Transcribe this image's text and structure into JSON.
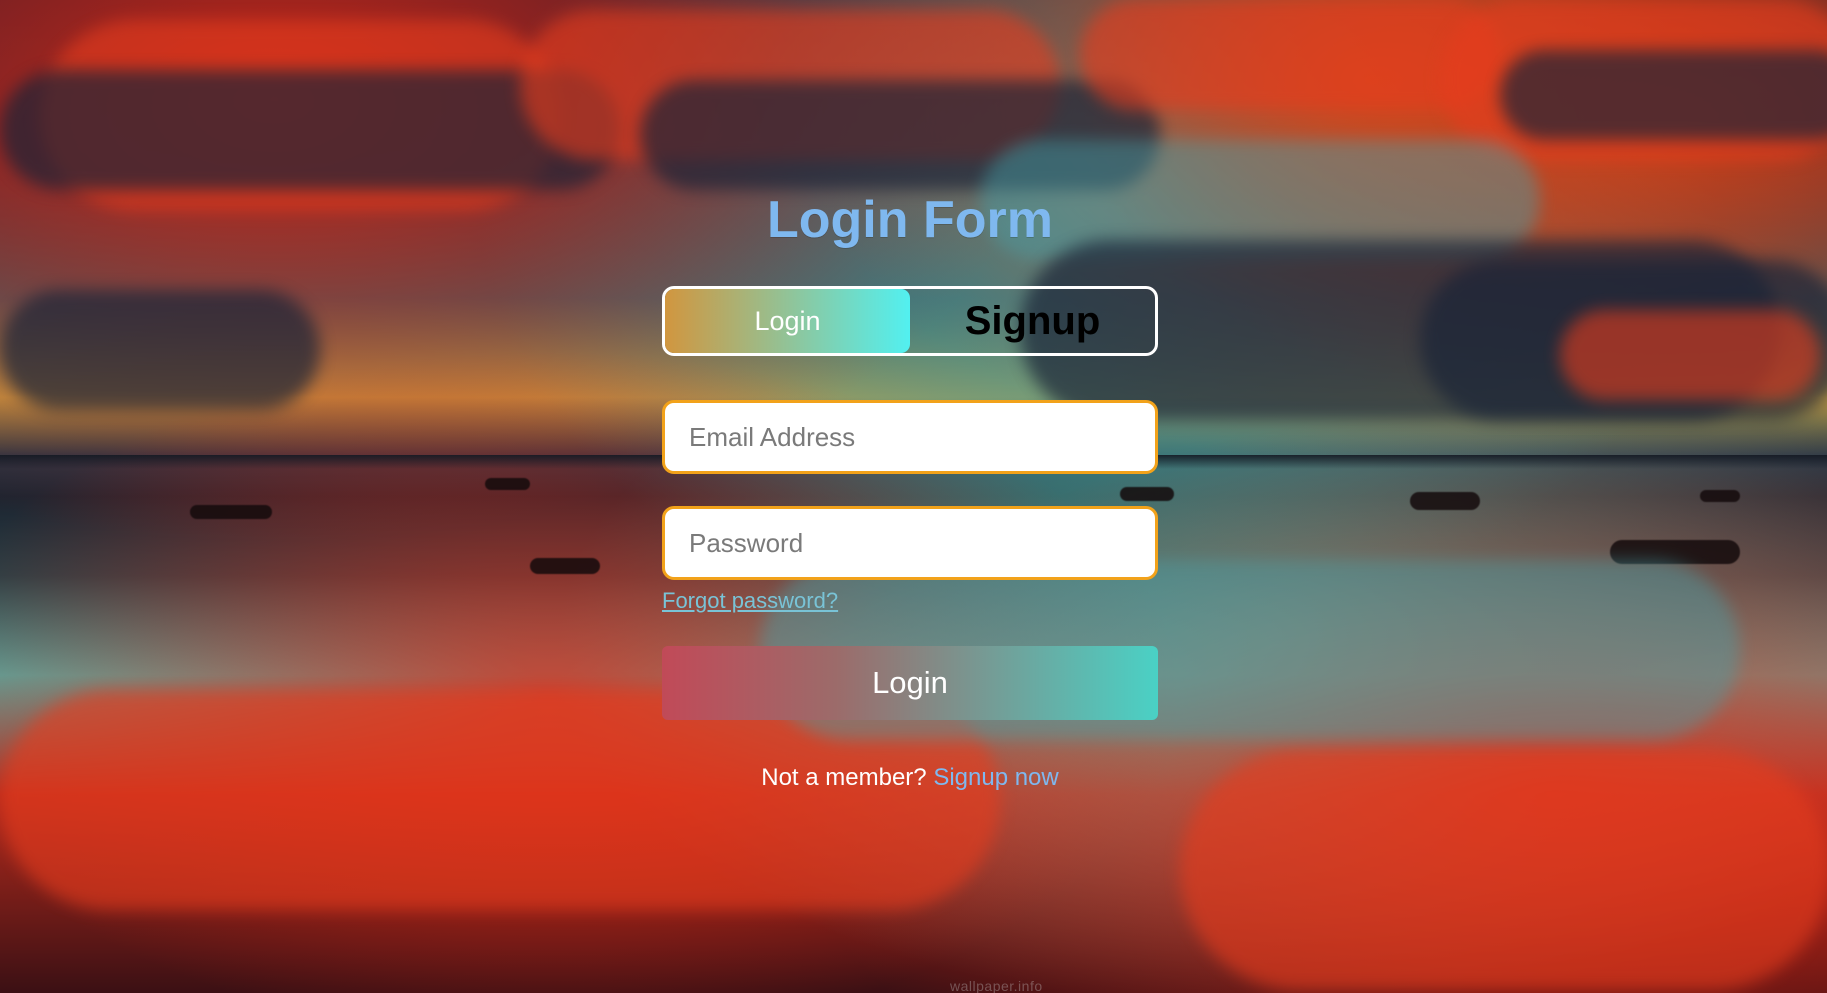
{
  "page": {
    "title": "Login Form"
  },
  "switch": {
    "login_label": "Login",
    "signup_label": "Signup"
  },
  "fields": {
    "email_placeholder": "Email Address",
    "password_placeholder": "Password"
  },
  "links": {
    "forgot_password": "Forgot password?"
  },
  "actions": {
    "submit_label": "Login"
  },
  "footer": {
    "not_member_text": "Not a member?",
    "signup_now": "Signup now"
  },
  "watermark": {
    "text": "wallpaper.info"
  },
  "colors": {
    "title": "#7fb8ef",
    "input_border": "#f2a21a"
  }
}
